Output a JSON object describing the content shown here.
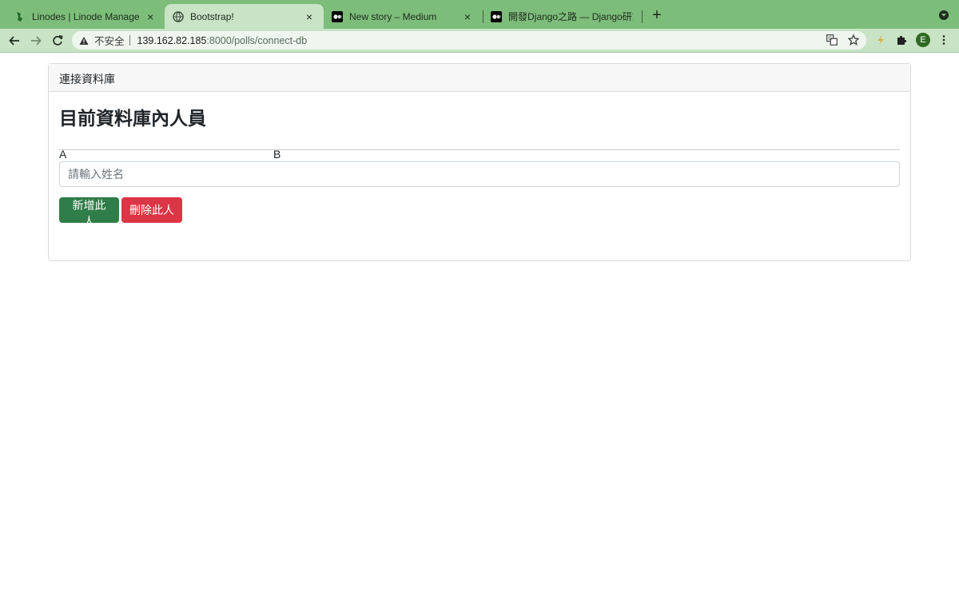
{
  "browser": {
    "tabs": [
      {
        "title": "Linodes | Linode Manager",
        "favicon": "linode-icon",
        "active": false
      },
      {
        "title": "Bootstrap!",
        "favicon": "globe-icon",
        "active": true
      },
      {
        "title": "New story – Medium",
        "favicon": "medium-icon",
        "active": false
      },
      {
        "title": "開發Django之路 — Django研究(",
        "favicon": "medium-icon",
        "active": false
      }
    ],
    "close_glyph": "×",
    "new_tab_glyph": "+",
    "address": {
      "security_label": "不安全",
      "host": "139.162.82.185",
      "path": ":8000/polls/connect-db"
    },
    "profile_initial": "E",
    "colors": {
      "frame": "#7dbd7a",
      "toolbar": "#c8e3c6"
    }
  },
  "page": {
    "card_header": "連接資料庫",
    "title": "目前資料庫內人員",
    "people": [
      "A",
      "B"
    ],
    "name_input": {
      "placeholder": "請輸入姓名",
      "value": ""
    },
    "add_button": "新增此人",
    "delete_button": "刪除此人",
    "colors": {
      "add": "#2f7d48",
      "delete": "#dc3545"
    }
  }
}
